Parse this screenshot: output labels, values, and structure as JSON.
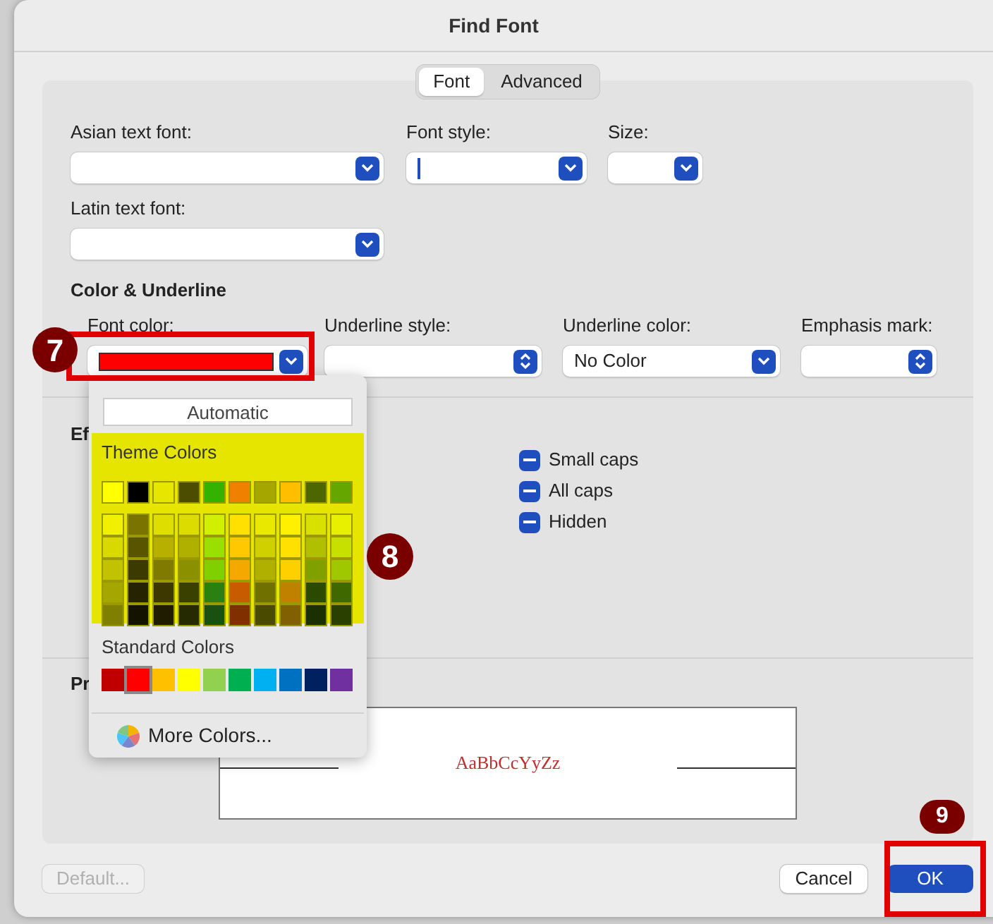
{
  "window": {
    "title": "Find Font"
  },
  "tabs": [
    {
      "label": "Font",
      "selected": true
    },
    {
      "label": "Advanced",
      "selected": false
    }
  ],
  "font_fields": [
    {
      "label": "Asian text font:",
      "kind": "popup",
      "focused": false
    },
    {
      "label": "Font style:",
      "kind": "popup",
      "focused": true
    },
    {
      "label": "Size:",
      "kind": "popup",
      "focused": false
    }
  ],
  "latin_field": {
    "label": "Latin text font:",
    "kind": "popup"
  },
  "color_section": {
    "heading": "Color & Underline",
    "fields": [
      {
        "label": "Font color:",
        "kind": "swatch",
        "color": "#ff0000"
      },
      {
        "label": "Underline style:",
        "kind": "stepper"
      },
      {
        "label": "Underline color:",
        "kind": "popup",
        "value": "No Color"
      },
      {
        "label": "Emphasis mark:",
        "kind": "stepper"
      }
    ]
  },
  "effects": {
    "heading": "Ef",
    "checkboxes": [
      {
        "label": "Small caps",
        "mixed": true
      },
      {
        "label": "All caps",
        "mixed": true
      },
      {
        "label": "Hidden",
        "mixed": true
      }
    ]
  },
  "preview": {
    "heading": "Pr",
    "sample": "AaBbCcYyZz"
  },
  "buttons": {
    "default": {
      "label": "Default...",
      "disabled": true
    },
    "cancel": {
      "label": "Cancel"
    },
    "ok": {
      "label": "OK"
    }
  },
  "color_popup": {
    "automatic": "Automatic",
    "theme_label": "Theme Colors",
    "theme_row": [
      {
        "color": "#ffff00",
        "selected": false
      },
      {
        "color": "#000000",
        "selected": false
      },
      {
        "color": "#e6e600",
        "selected": false
      },
      {
        "color": "#4d4d00",
        "selected": false
      },
      {
        "color": "#33b300",
        "selected": false
      },
      {
        "color": "#f08000",
        "selected": false
      },
      {
        "color": "#a6a600",
        "selected": false
      },
      {
        "color": "#ffbf00",
        "selected": false
      },
      {
        "color": "#4d6600",
        "selected": false
      },
      {
        "color": "#66a600",
        "selected": false
      }
    ],
    "theme_shades": [
      {
        "shades": [
          {
            "color": "#f0f000"
          },
          {
            "color": "#d9d900"
          },
          {
            "color": "#c2c200"
          },
          {
            "color": "#a6a600"
          },
          {
            "color": "#808000"
          }
        ]
      },
      {
        "shades": [
          {
            "color": "#7a7300"
          },
          {
            "color": "#595400"
          },
          {
            "color": "#3d3a00"
          },
          {
            "color": "#262400"
          },
          {
            "color": "#141300"
          }
        ]
      },
      {
        "shades": [
          {
            "color": "#dede00"
          },
          {
            "color": "#b8b000"
          },
          {
            "color": "#807a00"
          },
          {
            "color": "#3d3800"
          },
          {
            "color": "#1f1c00"
          }
        ]
      },
      {
        "shades": [
          {
            "color": "#dcdc00"
          },
          {
            "color": "#b0b000"
          },
          {
            "color": "#8a9000"
          },
          {
            "color": "#3a4000"
          },
          {
            "color": "#262a00"
          }
        ]
      },
      {
        "shades": [
          {
            "color": "#d0f000"
          },
          {
            "color": "#99e000"
          },
          {
            "color": "#80d000"
          },
          {
            "color": "#2a8010"
          },
          {
            "color": "#1a5010"
          }
        ]
      },
      {
        "shades": [
          {
            "color": "#ffe000"
          },
          {
            "color": "#ffc800"
          },
          {
            "color": "#f5a800"
          },
          {
            "color": "#c85a00"
          },
          {
            "color": "#803000"
          }
        ]
      },
      {
        "shades": [
          {
            "color": "#e8e800"
          },
          {
            "color": "#d0d000"
          },
          {
            "color": "#b0b000"
          },
          {
            "color": "#707000"
          },
          {
            "color": "#4a4a00"
          }
        ]
      },
      {
        "shades": [
          {
            "color": "#fff000"
          },
          {
            "color": "#ffe000"
          },
          {
            "color": "#ffd000"
          },
          {
            "color": "#c08000"
          },
          {
            "color": "#806000"
          }
        ]
      },
      {
        "shades": [
          {
            "color": "#d8e000"
          },
          {
            "color": "#b0c000"
          },
          {
            "color": "#80a000"
          },
          {
            "color": "#2a4a00"
          },
          {
            "color": "#1a3000"
          }
        ]
      },
      {
        "shades": [
          {
            "color": "#e8f000"
          },
          {
            "color": "#c8e000"
          },
          {
            "color": "#a0c800"
          },
          {
            "color": "#406800"
          },
          {
            "color": "#2a4000"
          }
        ]
      }
    ],
    "standard_label": "Standard Colors",
    "standard": [
      {
        "color": "#c00000",
        "selected": false
      },
      {
        "color": "#ff0000",
        "selected": true
      },
      {
        "color": "#ffc000",
        "selected": false
      },
      {
        "color": "#ffff00",
        "selected": false
      },
      {
        "color": "#92d050",
        "selected": false
      },
      {
        "color": "#00b050",
        "selected": false
      },
      {
        "color": "#00b0f0",
        "selected": false
      },
      {
        "color": "#0070c0",
        "selected": false
      },
      {
        "color": "#002060",
        "selected": false
      },
      {
        "color": "#7030a0",
        "selected": false
      }
    ],
    "more": "More Colors..."
  },
  "callouts": [
    {
      "number": "7"
    },
    {
      "number": "8"
    },
    {
      "number": "9"
    }
  ]
}
